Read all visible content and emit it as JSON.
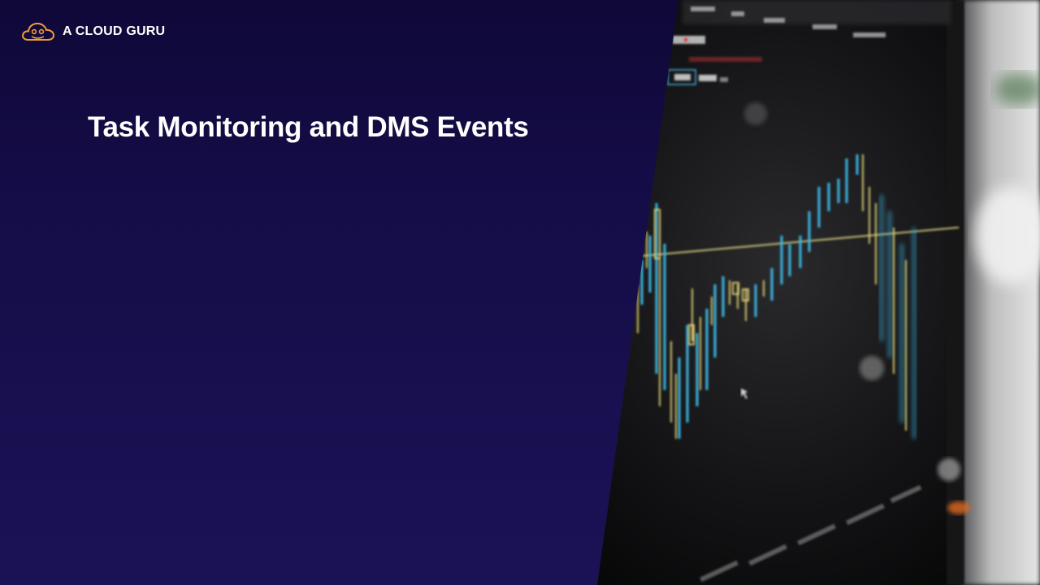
{
  "brand": {
    "name": "A CLOUD GURU",
    "accent_color": "#f29b38",
    "logo_icon": "cloud-logo-icon"
  },
  "slide": {
    "title": "Task Monitoring and DMS Events"
  },
  "photo": {
    "subject": "stock-chart-monitor-photo"
  },
  "colors": {
    "background_top": "#0f0838",
    "background_bottom": "#1b1256"
  }
}
